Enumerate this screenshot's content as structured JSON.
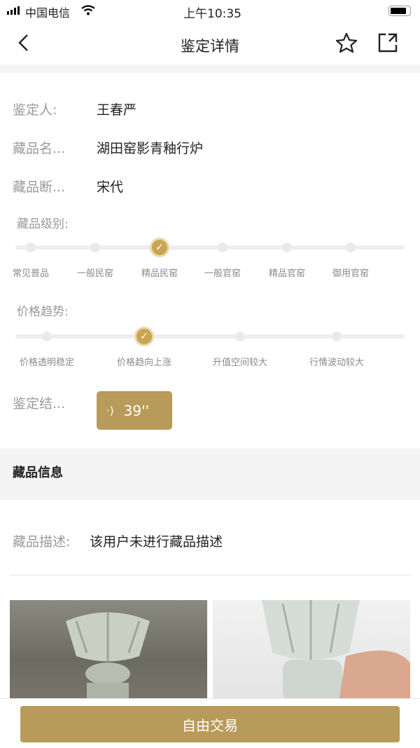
{
  "status_bar": {
    "carrier": "中国电信",
    "time": "上午10:35"
  },
  "nav": {
    "title": "鉴定详情",
    "icons": [
      "back-chevron-icon",
      "star-icon",
      "share-icon"
    ]
  },
  "details": [
    {
      "label": "鉴定人:",
      "value": "王春严"
    },
    {
      "label": "藏品名...",
      "value": "湖田窑影青釉行炉"
    },
    {
      "label": "藏品断...",
      "value": "宋代"
    }
  ],
  "grade": {
    "label": "藏品级别:",
    "options": [
      "常见普品",
      "一般民窑",
      "精品民窑",
      "一般官窑",
      "精品官窑",
      "御用官窑"
    ],
    "selected_index": 2
  },
  "trend": {
    "label": "价格趋势:",
    "options": [
      "价格透明稳定",
      "价格趋向上涨",
      "升值空间较大",
      "行情波动较大"
    ],
    "selected_index": 1
  },
  "result": {
    "label": "鉴定结...",
    "audio_duration": "39''"
  },
  "info_section": {
    "title": "藏品信息",
    "desc_label": "藏品描述:",
    "desc_value": "该用户未进行藏品描述"
  },
  "footer": {
    "button": "自由交易"
  },
  "colors": {
    "accent": "#b89a5a",
    "selected_dot": "#c9a552"
  }
}
